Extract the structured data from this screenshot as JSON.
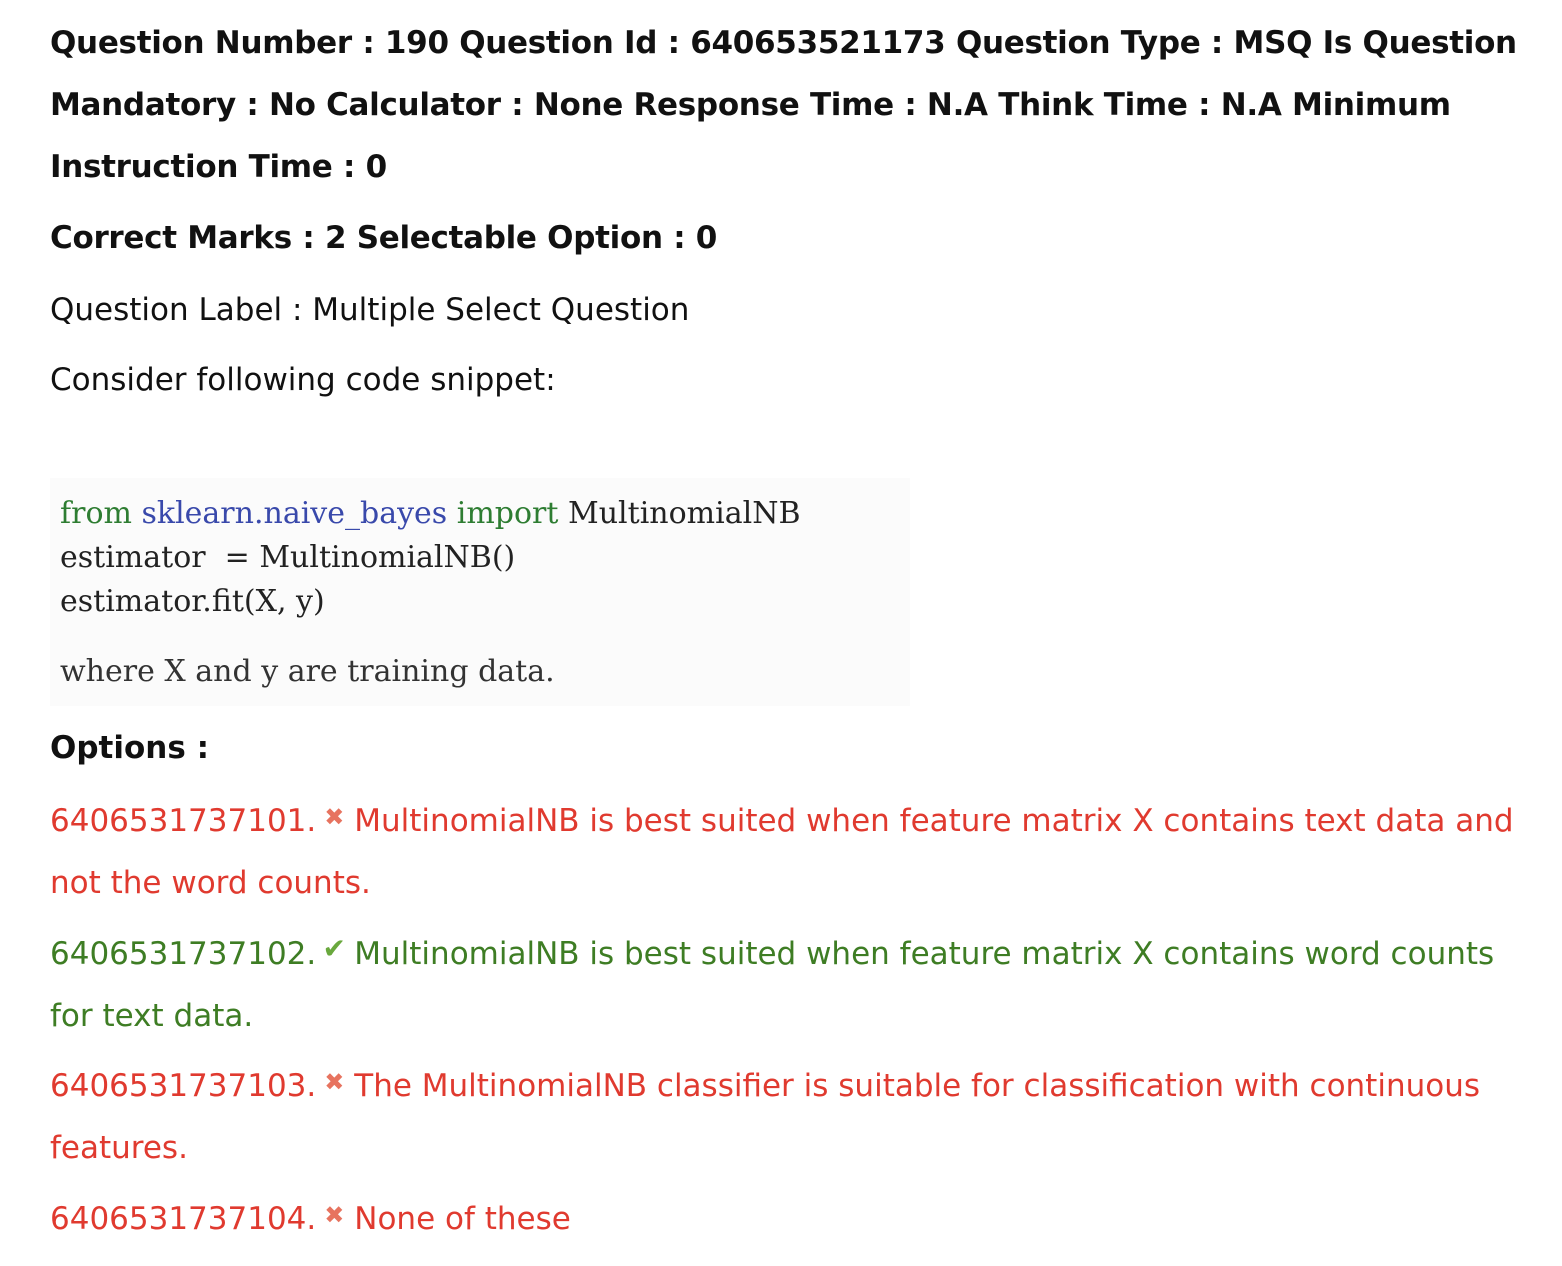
{
  "header": {
    "line1": "Question Number : 190 Question Id : 640653521173 Question Type : MSQ Is Question Mandatory : No Calculator : None Response Time : N.A Think Time : N.A Minimum Instruction Time : 0",
    "line2": "Correct Marks : 2 Selectable Option : 0"
  },
  "question": {
    "label": "Question Label : Multiple Select Question",
    "text": "Consider following code snippet:",
    "code": {
      "kw_from": "from",
      "module": "sklearn.naive_bayes",
      "kw_import": "import",
      "cls": "MultinomialNB",
      "line2": "estimator  = MultinomialNB()",
      "line3": "estimator.fit(X, y)"
    },
    "note": "where X and y are training data."
  },
  "options_heading": "Options :",
  "options": [
    {
      "id": "6406531737101.",
      "status": "wrong",
      "icon": "cross-icon",
      "text": "MultinomialNB is best suited when feature matrix X contains text data and not the word counts."
    },
    {
      "id": "6406531737102.",
      "status": "correct",
      "icon": "check-icon",
      "text": "MultinomialNB is best suited when feature matrix X contains word counts for text data."
    },
    {
      "id": "6406531737103.",
      "status": "wrong",
      "icon": "cross-icon",
      "text": "The MultinomialNB classifier is suitable for classification with continuous features."
    },
    {
      "id": "6406531737104.",
      "status": "wrong",
      "icon": "cross-icon",
      "text": "None of these"
    }
  ],
  "colors": {
    "wrong": "#e03a2f",
    "correct": "#3e7d24"
  }
}
